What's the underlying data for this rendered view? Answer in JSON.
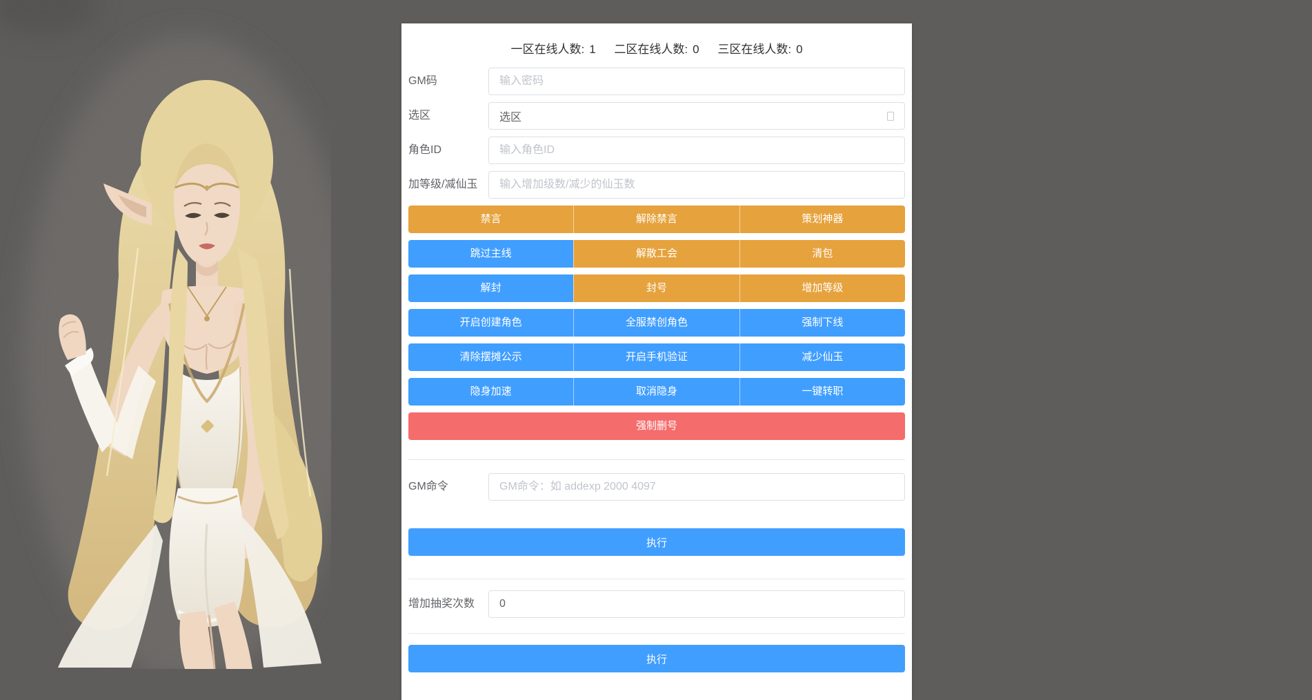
{
  "page": {
    "background_color": "#5E5D5B",
    "panel_color": "#FFFFFF"
  },
  "colors": {
    "primary_blue": "#409EFF",
    "warning_orange": "#E6A23C",
    "danger_red": "#F56C6C",
    "text_dark": "#303133",
    "text_label": "#606266",
    "placeholder": "#C0C4CC",
    "border": "#DCDFE6"
  },
  "stats": {
    "items": [
      {
        "label": "一区在线人数:",
        "value": "1"
      },
      {
        "label": "二区在线人数:",
        "value": "0"
      },
      {
        "label": "三区在线人数:",
        "value": "0"
      }
    ]
  },
  "form": {
    "gm_code": {
      "label": "GM码",
      "placeholder": "输入密码"
    },
    "zone": {
      "label": "选区",
      "value": "选区"
    },
    "role_id": {
      "label": "角色ID",
      "placeholder": "输入角色ID"
    },
    "level_jade": {
      "label": "加等级/减仙玉",
      "placeholder": "输入增加级数/减少的仙玉数"
    },
    "gm_command": {
      "label": "GM命令",
      "placeholder": "GM命令：如 addexp 2000 4097"
    },
    "lottery": {
      "label": "增加抽奖次数",
      "value": "0"
    }
  },
  "buttons": {
    "rows": [
      {
        "items": [
          {
            "label": "禁言",
            "style": "orange"
          },
          {
            "label": "解除禁言",
            "style": "orange"
          },
          {
            "label": "策划神器",
            "style": "orange"
          }
        ]
      },
      {
        "items": [
          {
            "label": "跳过主线",
            "style": "blue"
          },
          {
            "label": "解散工会",
            "style": "orange"
          },
          {
            "label": "清包",
            "style": "orange"
          }
        ]
      },
      {
        "items": [
          {
            "label": "解封",
            "style": "blue"
          },
          {
            "label": "封号",
            "style": "orange"
          },
          {
            "label": "增加等级",
            "style": "orange"
          }
        ]
      },
      {
        "items": [
          {
            "label": "开启创建角色",
            "style": "blue"
          },
          {
            "label": "全服禁创角色",
            "style": "blue"
          },
          {
            "label": "强制下线",
            "style": "blue"
          }
        ]
      },
      {
        "items": [
          {
            "label": "清除摆摊公示",
            "style": "blue"
          },
          {
            "label": "开启手机验证",
            "style": "blue"
          },
          {
            "label": "减少仙玉",
            "style": "blue"
          }
        ]
      },
      {
        "items": [
          {
            "label": "隐身加速",
            "style": "blue"
          },
          {
            "label": "取消隐身",
            "style": "blue"
          },
          {
            "label": "一键转职",
            "style": "blue"
          }
        ]
      }
    ],
    "force_delete": {
      "label": "强制删号",
      "style": "red"
    },
    "execute": {
      "label": "执行",
      "style": "blue"
    },
    "execute_bottom": {
      "label": "执行",
      "style": "blue"
    }
  },
  "illustration": {
    "description": "blonde elf woman in white and gold dress on gray background"
  }
}
